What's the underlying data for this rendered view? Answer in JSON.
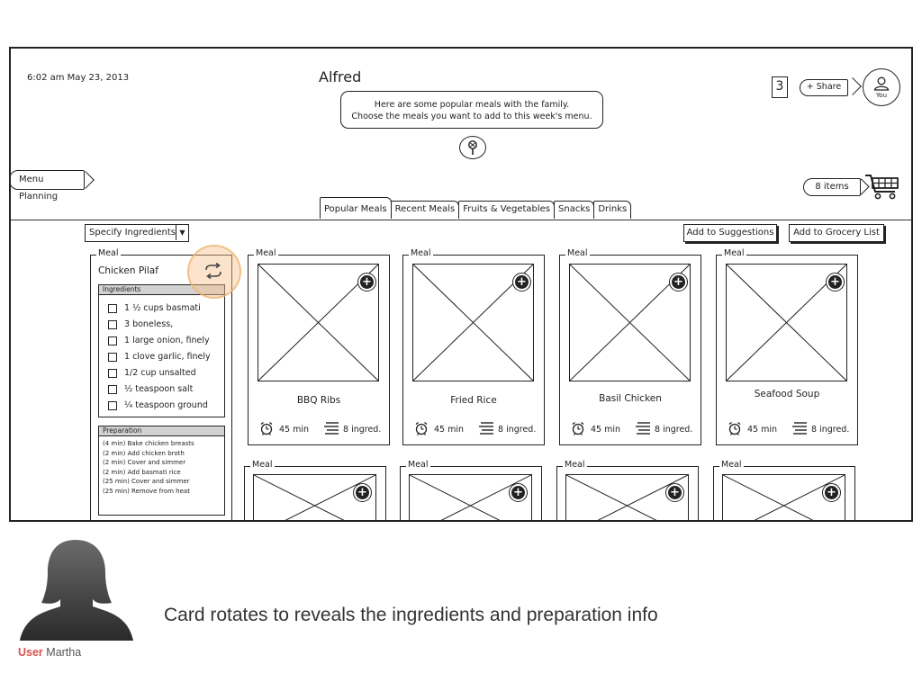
{
  "header": {
    "datetime": "6:02 am May 23, 2013",
    "assistant_name": "Alfred",
    "bubble_line1": "Here are some popular meals with the family.",
    "bubble_line2": "Choose the meals you want to add to this week's menu.",
    "counter": "3",
    "share_label": "+ Share",
    "avatar_label": "You"
  },
  "nav": {
    "menu_planning": "Menu Planning",
    "cart_items": "8 items"
  },
  "tabs": [
    {
      "label": "Popular Meals",
      "active": true
    },
    {
      "label": "Recent Meals",
      "active": false
    },
    {
      "label": "Fruits & Vegetables",
      "active": false
    },
    {
      "label": "Snacks",
      "active": false
    },
    {
      "label": "Drinks",
      "active": false
    }
  ],
  "toolbar": {
    "specify_ingredients": "Specify Ingredients",
    "add_to_suggestions": "Add to Suggestions",
    "add_to_grocery_list": "Add to Grocery List"
  },
  "detail_card": {
    "label": "Meal",
    "title": "Chicken Pilaf",
    "ingredients_header": "Ingredients",
    "ingredients": [
      "1 ½ cups basmati",
      "3 boneless,",
      "1 large onion, finely",
      "1 clove garlic, finely",
      "1/2 cup unsalted",
      "½ teaspoon salt",
      "¼ teaspoon ground"
    ],
    "preparation_header": "Preparation",
    "preparation": [
      "(4 min)  Bake chicken breasts",
      "(2 min) Add chicken broth",
      "(2 min)  Cover and simmer",
      "(2 min) Add basmati rice",
      "(25 min) Cover and simmer",
      "(25 min) Remove from heat"
    ]
  },
  "meals_row1": [
    {
      "label": "Meal",
      "name": "BBQ Ribs",
      "time": "45 min",
      "ingredients": "8 ingred."
    },
    {
      "label": "Meal",
      "name": "Fried Rice",
      "time": "45 min",
      "ingredients": "8 ingred."
    },
    {
      "label": "Meal",
      "name": "Basil Chicken",
      "time": "45 min",
      "ingredients": "8 ingred."
    },
    {
      "label": "Meal",
      "name": "Seafood Soup",
      "time": "45 min",
      "ingredients": "8 ingred."
    }
  ],
  "meals_row2": [
    {
      "label": "Meal"
    },
    {
      "label": "Meal"
    },
    {
      "label": "Meal"
    },
    {
      "label": "Meal"
    }
  ],
  "footer": {
    "caption": "Card rotates to reveals the ingredients and preparation info",
    "user_role": "User",
    "user_name": "Martha"
  }
}
